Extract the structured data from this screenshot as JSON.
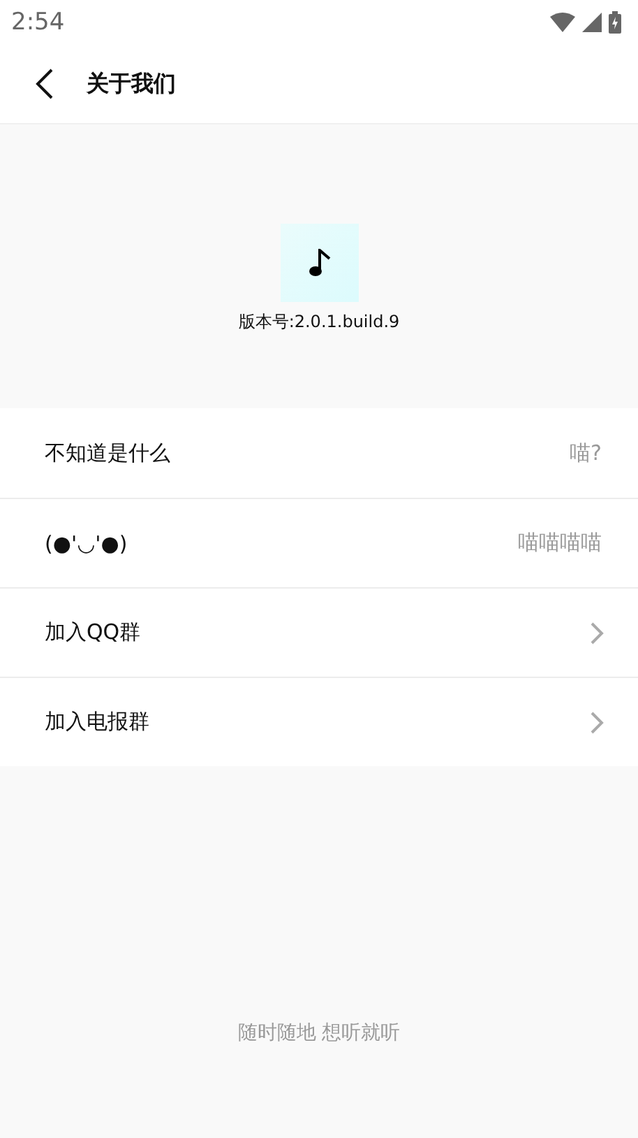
{
  "status_bar": {
    "time": "2:54"
  },
  "header": {
    "title": "关于我们"
  },
  "about": {
    "version": "版本号:2.0.1.build.9"
  },
  "rows": [
    {
      "kind": "value",
      "label": "不知道是什么",
      "value": "喵?"
    },
    {
      "kind": "value",
      "label": "(●'◡'●)",
      "value": "喵喵喵喵"
    },
    {
      "kind": "link",
      "label": "加入QQ群"
    },
    {
      "kind": "link",
      "label": "加入电报群"
    }
  ],
  "footer": {
    "slogan": "随时随地 想听就听"
  }
}
